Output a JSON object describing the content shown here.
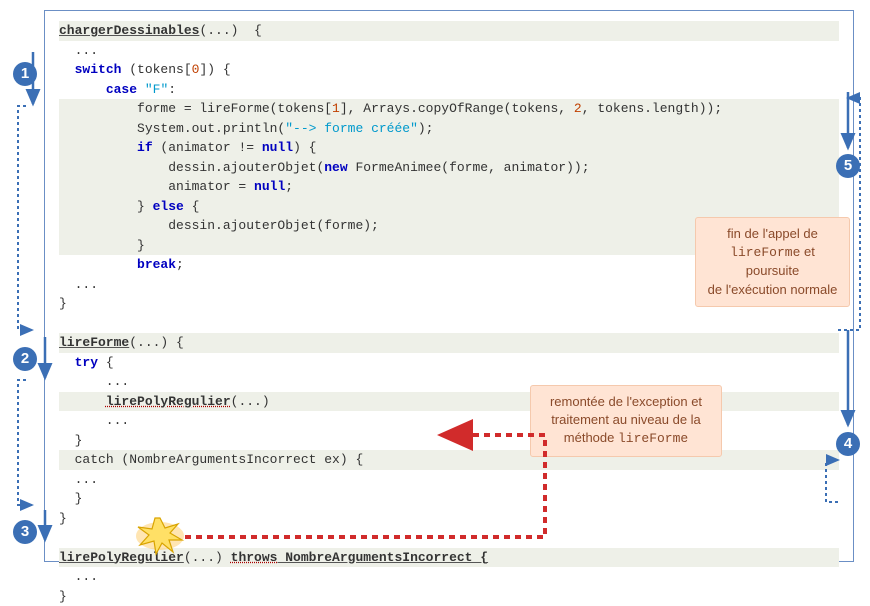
{
  "badges": {
    "b1": "1",
    "b2": "2",
    "b3": "3",
    "b4": "4",
    "b5": "5"
  },
  "note1": {
    "l1": "fin de l'appel de",
    "l2_code": "lireForme",
    "l2_rest": " et",
    "l3": "poursuite",
    "l4": "de l'exécution normale"
  },
  "note2": {
    "l1": "remontée de  l'exception et",
    "l2": "traitement au niveau de la",
    "l3_pre": "méthode ",
    "l3_code": "lireForme"
  },
  "code": {
    "m1": {
      "name": "chargerDessinables",
      "args": "(...)  {",
      "l1": "  ...",
      "l2_a": "  ",
      "l2_switch": "switch",
      "l2_b": " (tokens[",
      "l2_idx": "0",
      "l2_c": "]) {",
      "l3_a": "      ",
      "l3_case": "case",
      "l3_b": " ",
      "l3_str": "\"F\"",
      "l3_c": ":",
      "l4_a": "          forme = lireForme(tokens[",
      "l4_idx": "1",
      "l4_b": "], Arrays.copyOfRange(tokens, ",
      "l4_idx2": "2",
      "l4_c": ", tokens.length));",
      "l5_a": "          System.out.println(",
      "l5_str": "\"--> forme créée\"",
      "l5_b": ");",
      "l6_a": "          ",
      "l6_if": "if",
      "l6_b": " (animator != ",
      "l6_null": "null",
      "l6_c": ") {",
      "l7": "              dessin.ajouterObjet(",
      "l7_new": "new",
      "l7b": " FormeAnimee(forme, animator));",
      "l8_a": "              animator = ",
      "l8_null": "null",
      "l8_b": ";",
      "l9_a": "          } ",
      "l9_else": "else",
      "l9_b": " {",
      "l10": "              dessin.ajouterObjet(forme);",
      "l11": "          }",
      "l12_a": "          ",
      "l12_break": "break",
      "l12_b": ";",
      "l13": "  ...",
      "l14": "}"
    },
    "m2": {
      "name": "lireForme",
      "args": "(...) {",
      "l1_a": "  ",
      "l1_try": "try",
      "l1_b": " {",
      "l2": "      ...",
      "l3_a": "      ",
      "l3_call": "lirePolyRegulier",
      "l3_b": "(...)",
      "l4": "      ...",
      "l5": "  }",
      "l6_a": "  ",
      "l6_catch": "catch (NombreArgumentsIncorrect ex) {",
      "l7": "  ...",
      "l8": "  }",
      "l9": "}"
    },
    "m3": {
      "name": "lirePolyRegulier",
      "args": "(...) ",
      "throws": "throws",
      "thrown": " NombreArgumentsIncorrect {",
      "l1": "  ...",
      "l2": "}"
    }
  }
}
